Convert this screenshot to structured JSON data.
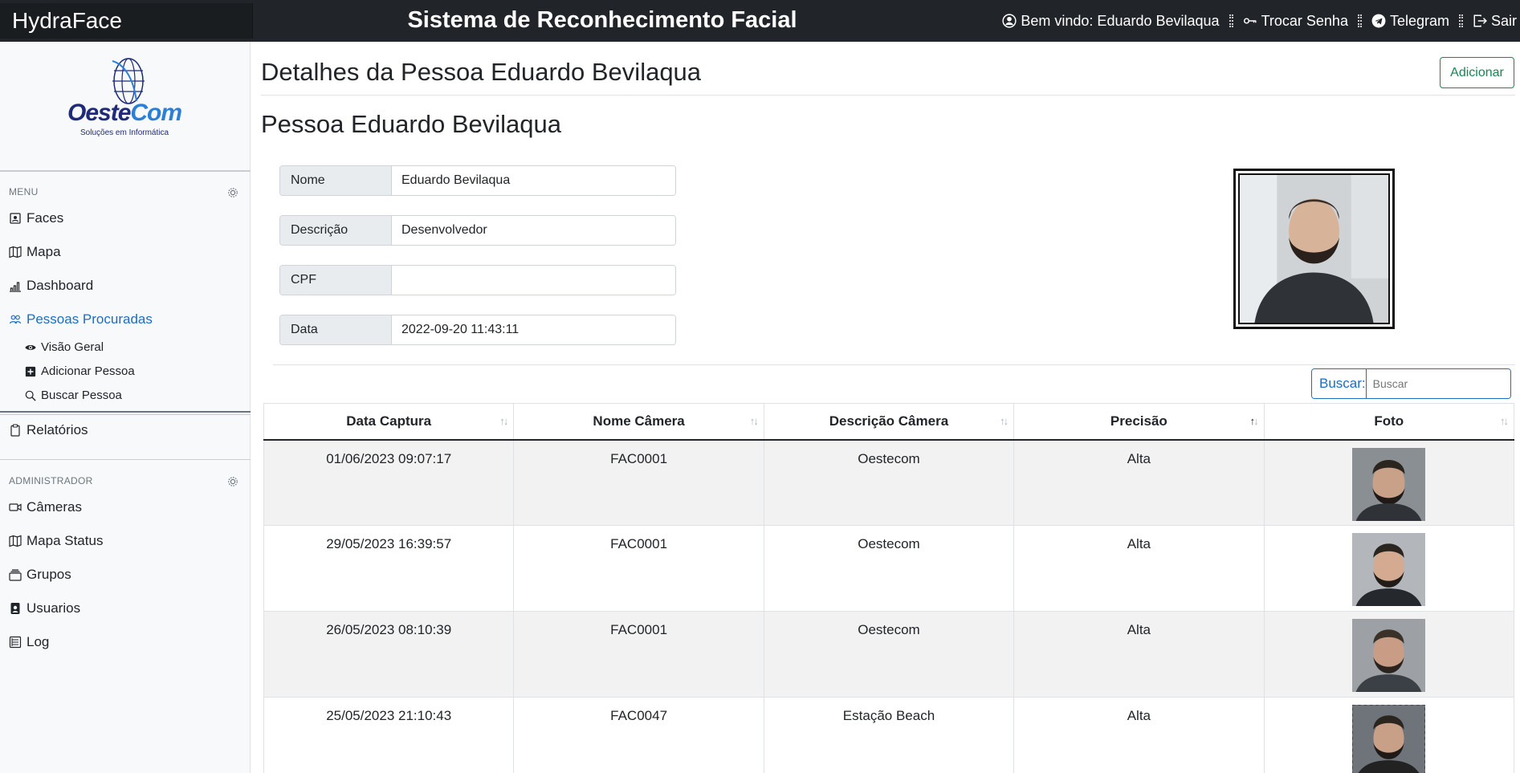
{
  "navbar": {
    "brand": "HydraFace",
    "title": "Sistema de Reconhecimento Facial",
    "welcome": "Bem vindo: Eduardo Bevilaqua",
    "change_password": "Trocar Senha",
    "telegram": "Telegram",
    "logout": "Sair"
  },
  "logo": {
    "name_part1": "Oeste",
    "name_part2": "Com",
    "tagline": "Soluções em Informática"
  },
  "sidebar": {
    "menu_heading": "MENU",
    "items": [
      {
        "label": "Faces",
        "icon": "person-badge-icon"
      },
      {
        "label": "Mapa",
        "icon": "map-icon"
      },
      {
        "label": "Dashboard",
        "icon": "bar-chart-icon"
      },
      {
        "label": "Pessoas Procuradas",
        "icon": "people-icon",
        "active": true
      }
    ],
    "subitems": [
      {
        "label": "Visão Geral",
        "icon": "eye-icon"
      },
      {
        "label": "Adicionar Pessoa",
        "icon": "plus-square-icon"
      },
      {
        "label": "Buscar Pessoa",
        "icon": "search-icon"
      }
    ],
    "reports": "Relatórios",
    "admin_heading": "ADMINISTRADOR",
    "admin_items": [
      {
        "label": "Câmeras",
        "icon": "camera-video-icon"
      },
      {
        "label": "Mapa Status",
        "icon": "map-icon"
      },
      {
        "label": "Grupos",
        "icon": "collection-icon"
      },
      {
        "label": "Usuarios",
        "icon": "person-square-icon"
      },
      {
        "label": "Log",
        "icon": "journal-icon"
      }
    ]
  },
  "main": {
    "page_title": "Detalhes da Pessoa Eduardo Bevilaqua",
    "add_button": "Adicionar",
    "sub_title": "Pessoa Eduardo Bevilaqua",
    "fields": [
      {
        "label": "Nome",
        "value": "Eduardo Bevilaqua"
      },
      {
        "label": "Descrição",
        "value": "Desenvolvedor"
      },
      {
        "label": "CPF",
        "value": ""
      },
      {
        "label": "Data",
        "value": "2022-09-20 11:43:11"
      }
    ],
    "search_label": "Buscar:",
    "search_placeholder": "Buscar",
    "table": {
      "columns": [
        "Data Captura",
        "Nome Câmera",
        "Descrição Câmera",
        "Precisão",
        "Foto"
      ],
      "sorted_column": "Precisão",
      "rows": [
        {
          "data": "01/06/2023 09:07:17",
          "camera": "FAC0001",
          "descricao": "Oestecom",
          "precisao": "Alta"
        },
        {
          "data": "29/05/2023 16:39:57",
          "camera": "FAC0001",
          "descricao": "Oestecom",
          "precisao": "Alta"
        },
        {
          "data": "26/05/2023 08:10:39",
          "camera": "FAC0001",
          "descricao": "Oestecom",
          "precisao": "Alta"
        },
        {
          "data": "25/05/2023 21:10:43",
          "camera": "FAC0047",
          "descricao": "Estação Beach",
          "precisao": "Alta"
        }
      ]
    }
  },
  "colors": {
    "navbar_bg": "#212529",
    "accent_blue": "#1b6ec2",
    "success_green": "#198754"
  }
}
